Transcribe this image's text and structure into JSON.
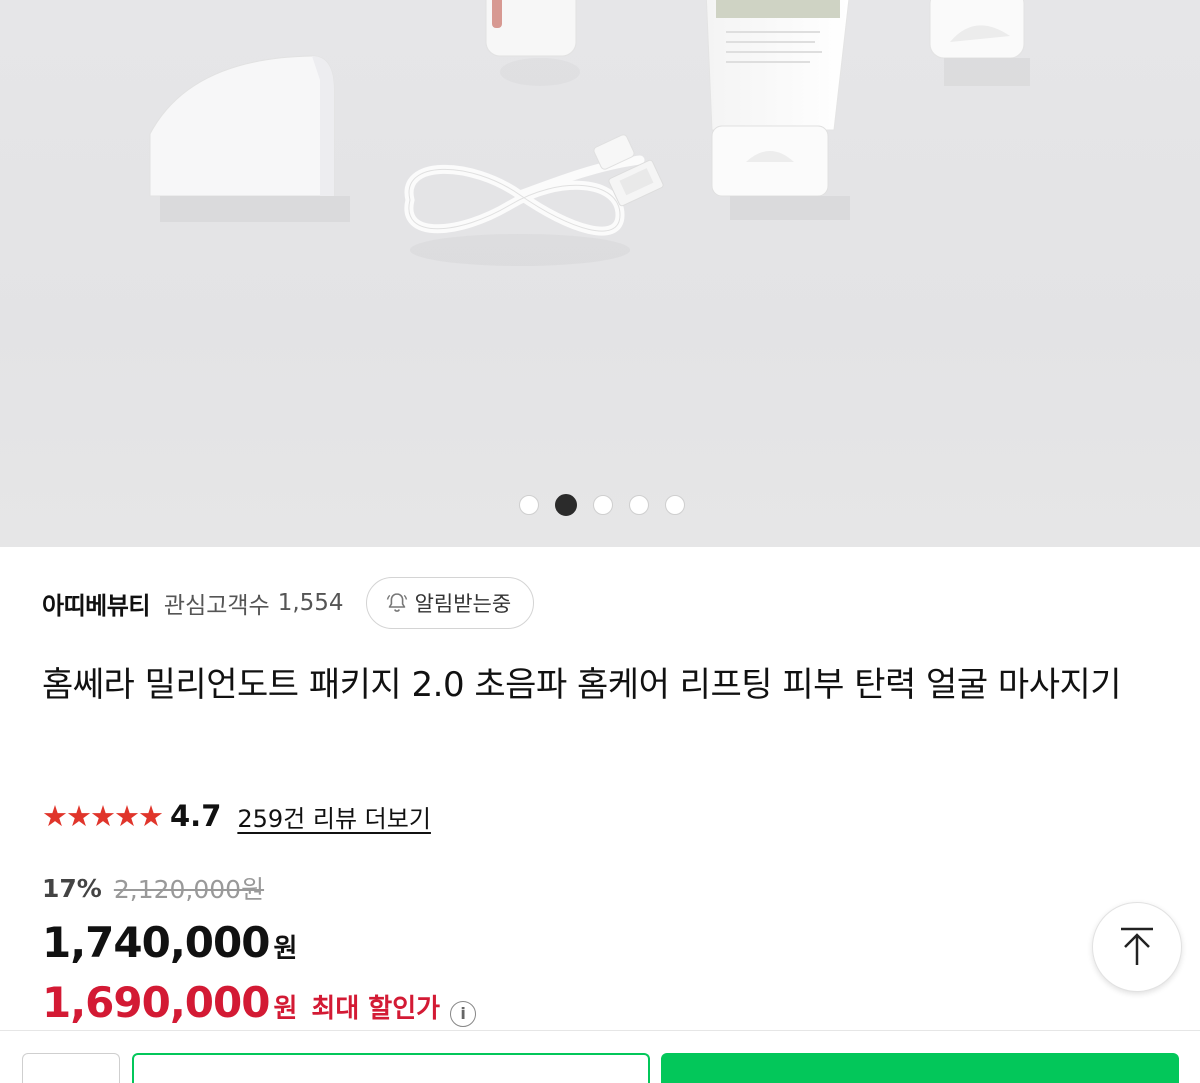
{
  "gallery": {
    "dots": [
      {
        "active": false
      },
      {
        "active": true
      },
      {
        "active": false
      },
      {
        "active": false
      },
      {
        "active": false
      }
    ]
  },
  "seller": {
    "name": "아띠베뷰티",
    "fan_label": "관심고객수",
    "fan_count": "1,554",
    "alarm_label": "알림받는중"
  },
  "product": {
    "title": "홈쎄라 밀리언도트 패키지 2.0 초음파 홈케어 리프팅 피부 탄력 얼굴 마사지기"
  },
  "rating": {
    "stars": "★★★★★",
    "score": "4.7",
    "review_link": "259건 리뷰 더보기"
  },
  "price": {
    "discount_rate": "17%",
    "original_price": "2,120,000원",
    "sale_price": "1,740,000",
    "currency": "원",
    "max_discount_price": "1,690,000",
    "max_discount_currency": "원",
    "max_discount_label": "최대 할인가",
    "info_icon": "i"
  },
  "colors": {
    "star": "#e0352b",
    "max_price": "#d31a34",
    "accent_green": "#03c75a"
  }
}
